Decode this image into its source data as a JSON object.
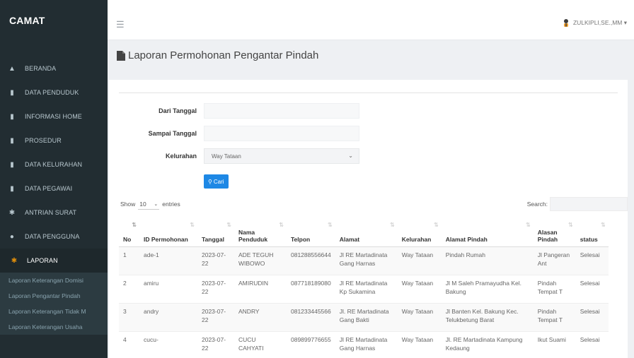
{
  "app": {
    "brand": "CAMAT"
  },
  "user": {
    "name": "ZULKIPLI,SE.,MM ▾"
  },
  "sidebar": {
    "items": [
      {
        "label": "BERANDA",
        "icon": "home-icon"
      },
      {
        "label": "DATA PENDUDUK",
        "icon": "file-icon"
      },
      {
        "label": "INFORMASI HOME",
        "icon": "file-icon"
      },
      {
        "label": "PROSEDUR",
        "icon": "file-icon"
      },
      {
        "label": "DATA KELURAHAN",
        "icon": "file-icon"
      },
      {
        "label": "DATA PEGAWAI",
        "icon": "file-icon"
      },
      {
        "label": "ANTRIAN SURAT",
        "icon": "gear-icon"
      },
      {
        "label": "DATA PENGGUNA",
        "icon": "user-icon"
      },
      {
        "label": "LAPORAN",
        "icon": "gear-icon"
      }
    ],
    "submenu": [
      "Laporan Keterangan Domisi",
      "Laporan Pengantar Pindah",
      "Laporan Keterangan Tidak M",
      "Laporan Keterangan Usaha"
    ]
  },
  "page": {
    "title": "Laporan Permohonan Pengantar Pindah"
  },
  "filter": {
    "from_label": "Dari Tanggal",
    "to_label": "Sampai Tanggal",
    "kelurahan_label": "Kelurahan",
    "kelurahan_value": "Way Tataan",
    "search_button": "Cari"
  },
  "table_controls": {
    "show_label": "Show",
    "entries_value": "10",
    "entries_label": "entries",
    "search_label": "Search:"
  },
  "table": {
    "headers": [
      "No",
      "ID Permohonan",
      "Tanggal",
      "Nama Penduduk",
      "Telpon",
      "Alamat",
      "Kelurahan",
      "Alamat Pindah",
      "Alasan Pindah",
      "status"
    ],
    "rows": [
      [
        "1",
        "ade-1",
        "2023-07-22",
        "ADE TEGUH WIBOWO",
        "081288556644",
        "Jl RE Martadinata Gang Harnas",
        "Way Tataan",
        "Pindah Rumah",
        "Jl Pangeran Ant",
        "Selesai"
      ],
      [
        "2",
        "amiru",
        "2023-07-22",
        "AMIRUDIN",
        "087718189080",
        "Jl RE Martadinata Kp Sukamina",
        "Way Tataan",
        "Jl M Saleh Pramayudha Kel. Bakung",
        "Pindah Tempat T",
        "Selesai"
      ],
      [
        "3",
        "andry",
        "2023-07-22",
        "ANDRY",
        "081233445566",
        "Jl. RE Martadinata Gang Bakti",
        "Way Tataan",
        "Jl Banten Kel. Bakung Kec. Telukbetung Barat",
        "Pindah Tempat T",
        "Selesai"
      ],
      [
        "4",
        "cucu-",
        "2023-07-22",
        "CUCU CAHYATI",
        "089899776655",
        "Jl RE Martadinata Gang Harnas",
        "Way Tataan",
        "Jl. RE Martadinata Kampung Kedaung",
        "Ikut Suami",
        "Selesai"
      ]
    ]
  }
}
